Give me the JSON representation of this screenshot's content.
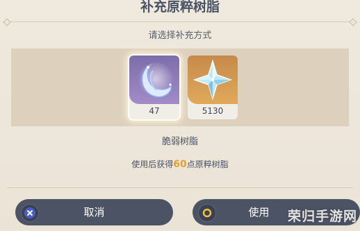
{
  "dialog": {
    "title": "补充原粹树脂",
    "prompt": "请选择补充方式",
    "items": [
      {
        "name": "moon-item",
        "count": "47"
      },
      {
        "name": "primogem-item",
        "count": "5130"
      }
    ],
    "selected_item_label": "脆弱树脂",
    "info_prefix": "使用后获得",
    "info_amount": "60",
    "info_suffix": "点原粹树脂"
  },
  "buttons": {
    "cancel_label": "取消",
    "use_label": "使用"
  },
  "watermark": "荣归手游网",
  "icons": {
    "cancel": "x-circle-icon",
    "confirm": "o-circle-icon",
    "moon": "crescent-moon-icon",
    "gem": "primogem-star-icon"
  },
  "colors": {
    "highlight_number": "#e0a233",
    "button_bg": "#4b5365",
    "selected_item_bg": "#8f7bbf",
    "gem_item_bg": "#d59b52"
  }
}
